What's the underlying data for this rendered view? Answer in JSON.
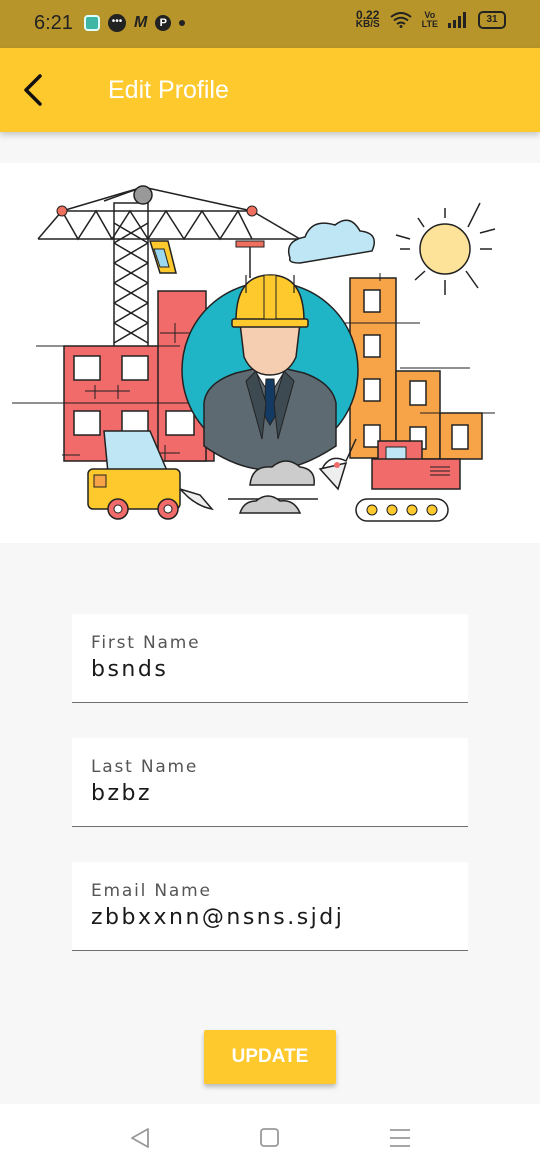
{
  "status_bar": {
    "time": "6:21",
    "net_speed_value": "0.22",
    "net_speed_unit": "KB/S",
    "vo_top": "Vo",
    "vo_bottom": "LTE",
    "battery": "31",
    "icons": [
      "app-icon",
      "chat-icon",
      "m-icon",
      "p-icon",
      "dot-icon",
      "wifi-icon",
      "signal-icon",
      "battery-icon"
    ]
  },
  "app_bar": {
    "title": "Edit Profile",
    "back_icon": "back-arrow-icon",
    "color": "#fdc92d"
  },
  "form": {
    "fields": [
      {
        "label": "First Name",
        "value": "bsnds"
      },
      {
        "label": "Last Name",
        "value": "bzbz"
      },
      {
        "label": "Email Name",
        "value": "zbbxxnn@nsns.sjdj"
      }
    ],
    "update_label": "UPDATE"
  },
  "nav_bar": {
    "icons": [
      "nav-back-icon",
      "nav-home-icon",
      "nav-recents-icon"
    ]
  },
  "colors": {
    "accent": "#fdc92d",
    "status_bar": "#b8952a"
  }
}
